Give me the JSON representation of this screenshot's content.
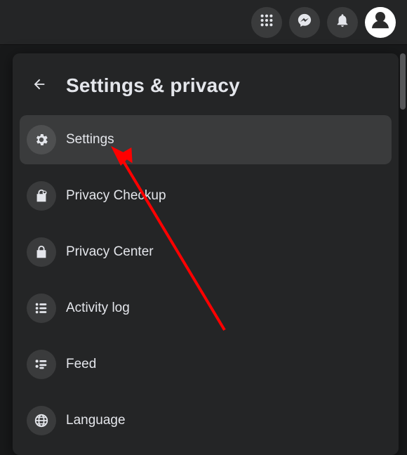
{
  "header": {
    "title": "Settings & privacy"
  },
  "menu": {
    "items": [
      {
        "label": "Settings",
        "icon": "gear-icon",
        "highlight": true
      },
      {
        "label": "Privacy Checkup",
        "icon": "lock-heart-icon",
        "highlight": false
      },
      {
        "label": "Privacy Center",
        "icon": "lock-icon",
        "highlight": false
      },
      {
        "label": "Activity log",
        "icon": "list-icon",
        "highlight": false
      },
      {
        "label": "Feed",
        "icon": "feed-icon",
        "highlight": false
      },
      {
        "label": "Language",
        "icon": "globe-icon",
        "highlight": false
      }
    ]
  },
  "annotation": {
    "type": "arrow",
    "color": "#ff0000",
    "target": "settings"
  }
}
